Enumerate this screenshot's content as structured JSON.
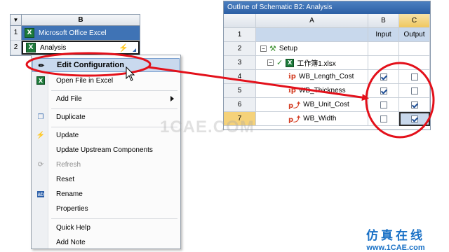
{
  "left_table": {
    "column": "B",
    "rows": [
      {
        "num": "1",
        "label": "Microsoft Office Excel"
      },
      {
        "num": "2",
        "label": "Analysis"
      }
    ]
  },
  "context_menu": {
    "items": [
      {
        "label": "Edit Configuration",
        "icon": "pencil-icon"
      },
      {
        "label": "Open File in Excel",
        "icon": "excel-icon"
      },
      {
        "label": "Add File",
        "icon": ""
      },
      {
        "label": "Duplicate",
        "icon": "duplicate-icon"
      },
      {
        "label": "Update",
        "icon": "lightning-icon"
      },
      {
        "label": "Update Upstream Components",
        "icon": ""
      },
      {
        "label": "Refresh",
        "icon": "refresh-icon"
      },
      {
        "label": "Reset",
        "icon": ""
      },
      {
        "label": "Rename",
        "icon": "rename-icon"
      },
      {
        "label": "Properties",
        "icon": ""
      },
      {
        "label": "Quick Help",
        "icon": ""
      },
      {
        "label": "Add Note",
        "icon": ""
      }
    ]
  },
  "outline": {
    "title": "Outline of Schematic B2: Analysis",
    "col_a": "A",
    "col_b": "B",
    "col_c": "C",
    "row1_b": "Input",
    "row1_c": "Output",
    "rows": [
      {
        "num": "1"
      },
      {
        "num": "2",
        "name": "Setup"
      },
      {
        "num": "3",
        "name": "工作簿1.xlsx"
      },
      {
        "num": "4",
        "name": "WB_Length_Cost",
        "input": true,
        "output": false
      },
      {
        "num": "5",
        "name": "WB_Thickness",
        "input": true,
        "output": false
      },
      {
        "num": "6",
        "name": "WB_Unit_Cost",
        "input": false,
        "output": true
      },
      {
        "num": "7",
        "name": "WB_Width",
        "input": false,
        "output": true
      }
    ]
  },
  "watermark": "1CAE.COM",
  "brand": {
    "cn": "仿真在线",
    "url": "www.1CAE.com"
  },
  "colors": {
    "annotation_red": "#e3101a",
    "selection_blue": "#c8d8ec",
    "header_blue": "#3f73b5"
  }
}
